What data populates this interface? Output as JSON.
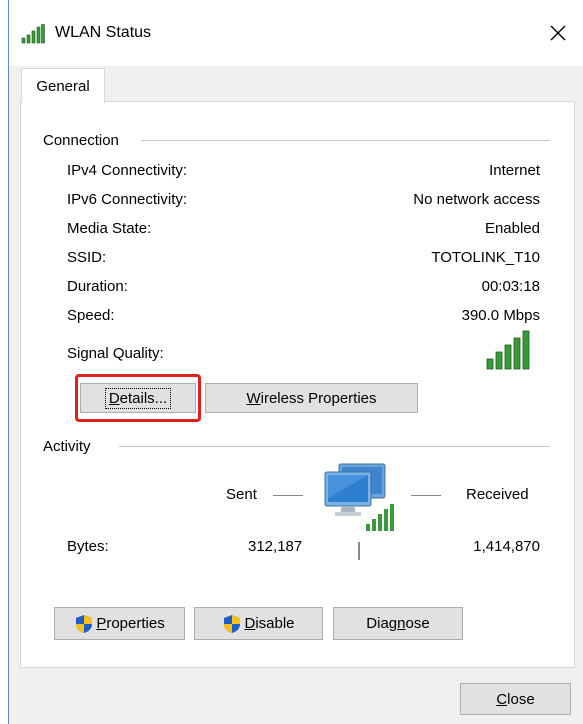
{
  "window": {
    "title": "WLAN Status",
    "icons": {
      "app": "wlan-signal-icon",
      "close": "close-icon"
    }
  },
  "tabs": [
    {
      "label": "General",
      "selected": true
    }
  ],
  "connection": {
    "group_label": "Connection",
    "rows": [
      {
        "label": "IPv4 Connectivity:",
        "value": "Internet"
      },
      {
        "label": "IPv6 Connectivity:",
        "value": "No network access"
      },
      {
        "label": "Media State:",
        "value": "Enabled"
      },
      {
        "label": "SSID:",
        "value": "TOTOLINK_T10"
      },
      {
        "label": "Duration:",
        "value": "00:03:18"
      },
      {
        "label": "Speed:",
        "value": "390.0 Mbps"
      }
    ],
    "signal_quality_label": "Signal Quality:",
    "signal_bars_filled": 5,
    "details_button": {
      "first": "D",
      "rest": "etails..."
    },
    "wireless_properties_button": {
      "first": "W",
      "rest": "ireless Properties"
    }
  },
  "activity": {
    "group_label": "Activity",
    "sent_label": "Sent",
    "received_label": "Received",
    "bytes_label": "Bytes:",
    "bytes_sent": "312,187",
    "bytes_received": "1,414,870",
    "network_icon": "network-computers-icon"
  },
  "buttons": {
    "properties": {
      "first": "P",
      "rest": "roperties"
    },
    "disable": {
      "first": "D",
      "rest": "isable"
    },
    "diagnose": {
      "pre": "Diag",
      "u": "n",
      "post": "ose"
    },
    "close": {
      "first": "C",
      "rest": "lose"
    }
  },
  "colors": {
    "signal_green": "#3a9a3a",
    "highlight_red": "#e0201c",
    "shield_blue": "#1e5cc8",
    "shield_yellow": "#f3c21b"
  }
}
